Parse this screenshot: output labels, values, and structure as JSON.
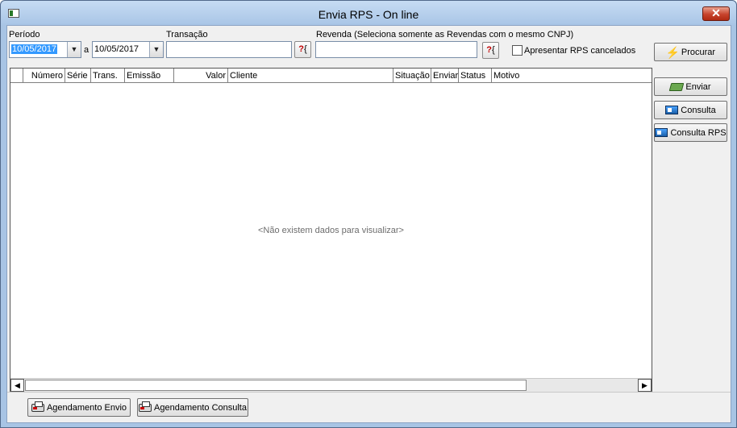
{
  "window": {
    "title": "Envia RPS - On line",
    "close_label": "✕"
  },
  "filters": {
    "periodo_label": "Período",
    "date_from": "10/05/2017",
    "date_to_sep": "a",
    "date_to": "10/05/2017",
    "transacao_label": "Transação",
    "transacao_value": "",
    "revenda_label": "Revenda (Seleciona somente as Revendas com o mesmo CNPJ)",
    "revenda_value": "",
    "lookup_label": "?",
    "cancelados_label": "Apresentar RPS cancelados",
    "cancelados_checked": false
  },
  "buttons": {
    "procurar": "Procurar",
    "enviar": "Enviar",
    "consulta": "Consulta",
    "consulta_rps": "Consulta RPS",
    "agendamento_envio": "Agendamento Envio",
    "agendamento_consulta": "Agendamento Consulta"
  },
  "grid": {
    "columns": [
      "Número",
      "Série",
      "Trans.",
      "Emissão",
      "Valor",
      "Cliente",
      "Situação",
      "Enviar",
      "Status",
      "Motivo"
    ],
    "empty_message": "<Não existem dados para visualizar>"
  },
  "icons": {
    "procurar": "lightning-icon",
    "enviar": "money-icon",
    "consulta": "monitor-icon",
    "consulta_rps": "monitor-icon",
    "agendamento": "printer-icon"
  }
}
